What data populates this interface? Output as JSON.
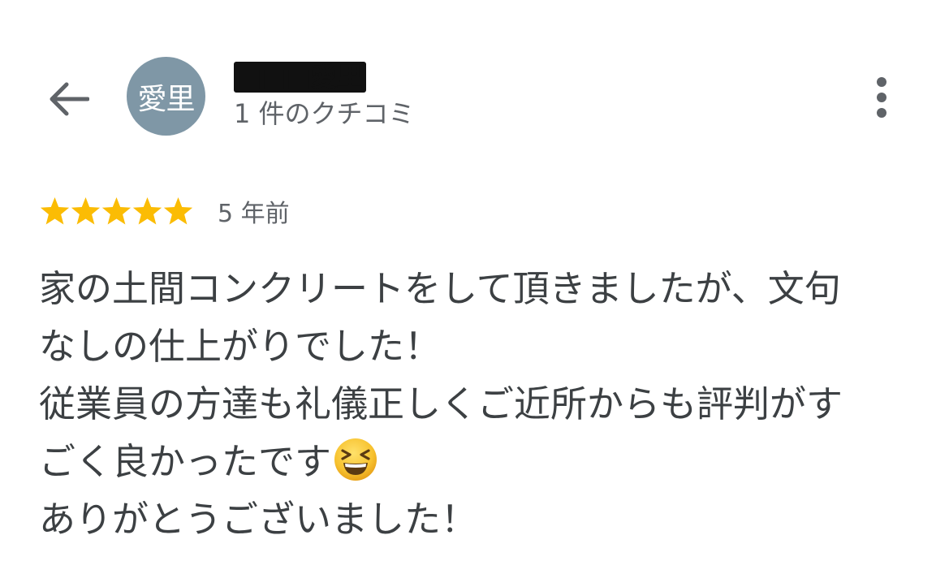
{
  "header": {
    "back_icon": "arrow-back-icon",
    "avatar_initials": "愛里",
    "user_name": "■■■愛里",
    "review_count": "1 件のクチコミ",
    "more_icon": "more-vert-icon"
  },
  "review": {
    "rating": 5,
    "max_rating": 5,
    "star_color": "#fbbc04",
    "time_ago": "5 年前",
    "lines": [
      "家の土間コンクリートをして頂きましたが、文句",
      "なしの仕上がりでした！",
      "従業員の方達も礼儀正しくご近所からも評判がす",
      "ごく良かったです",
      "ありがとうございました！"
    ],
    "emoji": "grinning-squinting-face"
  },
  "colors": {
    "avatar_bg": "#7f97a6",
    "text": "#3c4043",
    "secondary_text": "#5f6368",
    "icon": "#5f6368"
  }
}
